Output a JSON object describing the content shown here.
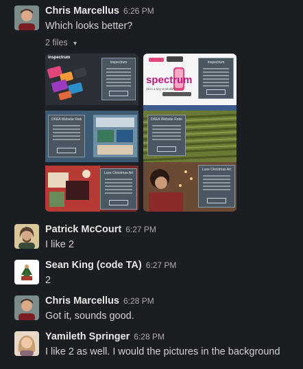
{
  "messages": [
    {
      "name": "Chris Marcellus",
      "time": "6:26 PM",
      "text": "Which looks better?"
    },
    {
      "name": "Patrick McCourt",
      "time": "6:27 PM",
      "text": "I like 2"
    },
    {
      "name": "Sean King (code TA)",
      "time": "6:27 PM",
      "text": "2"
    },
    {
      "name": "Chris Marcellus",
      "time": "6:28 PM",
      "text": "Got it, sounds good."
    },
    {
      "name": "Yamileth Springer",
      "time": "6:28 PM",
      "text": "I like 2 as well. I would the pictures in the background"
    }
  ],
  "attachments": {
    "label": "2 files",
    "files": [
      {
        "sections": [
          {
            "brand": "inspectrum",
            "panel_title": "Inspectrum",
            "button": "Click to view"
          },
          {
            "panel_title": "DKEA Website Redesign",
            "button": "Click to view"
          },
          {
            "panel_title": "Luxe Christmas Art",
            "button": "Click to view"
          }
        ]
      },
      {
        "sections": [
          {
            "brand": "spectrum",
            "tagline": "All in a tiny Unit/utility",
            "panel_title": "Inspectrum",
            "button": "Click to view"
          },
          {
            "panel_title": "DKEA Website Redesign",
            "button": "Click to view"
          },
          {
            "panel_title": "Luxe Christmas Art",
            "button": "Click to view"
          }
        ]
      }
    ]
  }
}
